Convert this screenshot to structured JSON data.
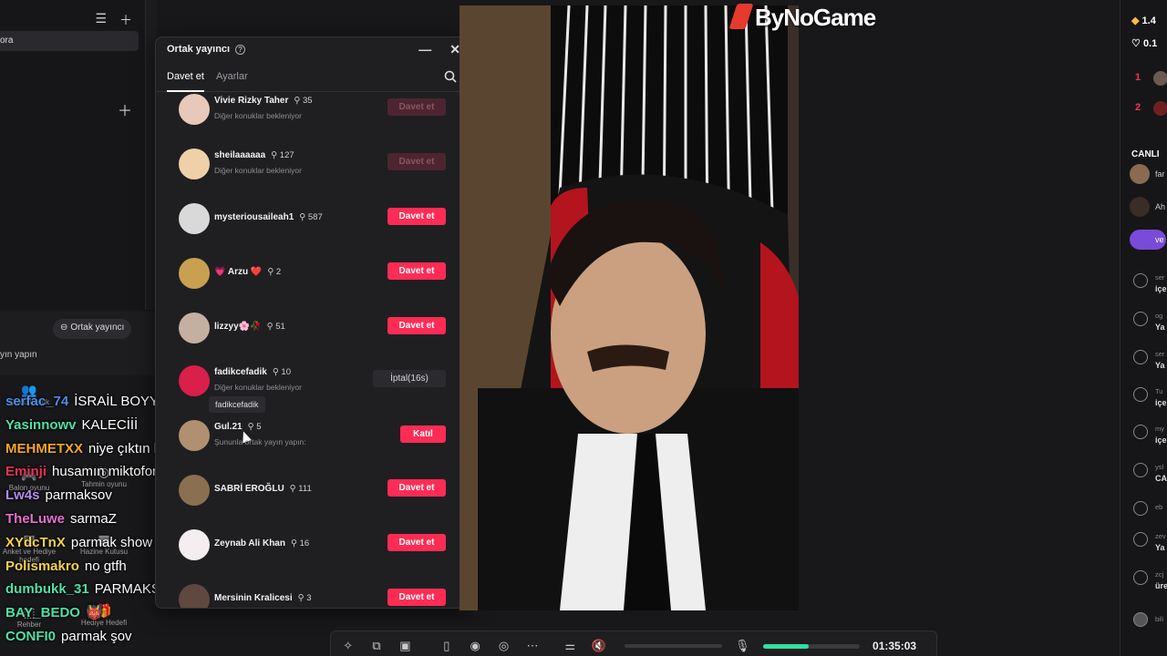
{
  "left_panel": {
    "selected_item": "ora",
    "cohost_chip": "Ortak yayıncı",
    "cta_text": "yın yapın"
  },
  "sidebar_icons": [
    {
      "label": "Çoklu konuk"
    },
    {
      "label": "Balon oyunu"
    },
    {
      "label": "Tahmin oyunu"
    },
    {
      "label": "Anket ve Hediye hedefi"
    },
    {
      "label": "Hazine Kutusu"
    },
    {
      "label": "Rehber"
    },
    {
      "label": "Hediye Hedefi"
    }
  ],
  "chat": [
    {
      "user": "serfac_74",
      "color": "#4a8fe8",
      "message": "İSRAİL BOYYKOTT"
    },
    {
      "user": "Yasinnowv",
      "color": "#4fe0a5",
      "message": "KALECİİİ"
    },
    {
      "user": "MEHMETXX",
      "color": "#f5a623",
      "message": "niye çıktın la"
    },
    {
      "user": "Eminji",
      "color": "#e8315a",
      "message": "husamın miktofon quadcast mi"
    },
    {
      "user": "Lw4s",
      "color": "#b38cf2",
      "message": "parmaksov"
    },
    {
      "user": "TheLuwe",
      "color": "#e96fd0",
      "message": "sarmaZ"
    },
    {
      "user": "XYdcTnX",
      "color": "#f5d24a",
      "message": "parmak show"
    },
    {
      "user": "Polismakro",
      "color": "#f5d24a",
      "message": "no gtfh"
    },
    {
      "user": "dumbukk_31",
      "color": "#4fe0a5",
      "message": "PARMAKSHOW ABİ"
    },
    {
      "user": "BAY_BEDO",
      "color": "#4fe0a5",
      "message": "👹"
    },
    {
      "user": "CONFI0",
      "color": "#4fe0a5",
      "message": "parmak şov"
    }
  ],
  "dialog": {
    "title": "Ortak yayıncı",
    "tabs": [
      "Davet et",
      "Ayarlar"
    ],
    "tooltip": "fadikcefadik",
    "rows": [
      {
        "name": "Vivie Rizky Taher",
        "count": "35",
        "sub": "Diğer konuklar bekleniyor",
        "button": "Davet et",
        "state": "dim",
        "avatar": "#e8c8b8"
      },
      {
        "name": "sheilaaaaaa",
        "count": "127",
        "sub": "Diğer konuklar bekleniyor",
        "button": "Davet et",
        "state": "dim",
        "avatar": "#f0d0a8"
      },
      {
        "name": "mysteriousaileah1",
        "count": "587",
        "sub": "",
        "button": "Davet et",
        "state": "active",
        "avatar": "#d9d9d9"
      },
      {
        "name": "💗 Arzu ❤️",
        "count": "2",
        "sub": "",
        "button": "Davet et",
        "state": "active",
        "avatar": "#c8a050"
      },
      {
        "name": "lizzyy🌸🥀",
        "count": "51",
        "sub": "",
        "button": "Davet et",
        "state": "active",
        "avatar": "#c4b0a0"
      },
      {
        "name": "fadikcefadik",
        "count": "10",
        "sub": "Diğer konuklar bekleniyor",
        "button": "İptal(16s)",
        "state": "cancel",
        "avatar": "#d8204a"
      },
      {
        "name": "Gul.21",
        "count": "5",
        "sub": "Şununla ortak yayın yapın:",
        "button": "Katıl",
        "state": "join",
        "avatar": "#b09070"
      },
      {
        "name": "SABRİ EROĞLU",
        "count": "111",
        "sub": "",
        "button": "Davet et",
        "state": "active",
        "avatar": "#8a7050"
      },
      {
        "name": "Zeynab Ali Khan",
        "count": "16",
        "sub": "",
        "button": "Davet et",
        "state": "active",
        "avatar": "#f5eef0"
      },
      {
        "name": "Mersinin Kralicesi",
        "count": "3",
        "sub": "",
        "button": "Davet et",
        "state": "active",
        "avatar": "#604840"
      }
    ]
  },
  "logo": "ByNoGame",
  "right_panel": {
    "diamonds": "1.4",
    "likes": "0.1",
    "ranks": [
      "1",
      "2"
    ],
    "canli": "CANLI",
    "guests": [
      "far",
      "Ah",
      "ve"
    ],
    "activity": [
      {
        "top": "ser",
        "bottom": "içe"
      },
      {
        "top": "og",
        "bottom": "Ya"
      },
      {
        "top": "ser",
        "bottom": "Ya"
      },
      {
        "top": "Tu",
        "bottom": "içe"
      },
      {
        "top": "my",
        "bottom": "içe"
      },
      {
        "top": "ysl",
        "bottom": "CA"
      },
      {
        "top": "eb",
        "bottom": ""
      },
      {
        "top": "zev",
        "bottom": "Ya"
      },
      {
        "top": "zcj",
        "bottom": "üre"
      },
      {
        "top": "bili",
        "bottom": ""
      }
    ]
  },
  "toolbar": {
    "time": "01:35:03",
    "mic_level": 0.47
  },
  "colors": {
    "accent": "#fe2c55",
    "mic": "#2fe0a0"
  }
}
